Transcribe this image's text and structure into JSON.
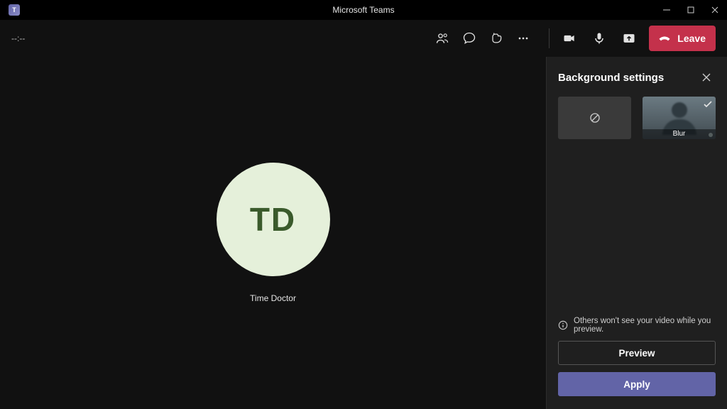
{
  "window": {
    "app_icon_text": "T",
    "title": "Microsoft Teams"
  },
  "toolbar": {
    "timer": "--:--",
    "leave_label": "Leave"
  },
  "stage": {
    "avatar_initials": "TD",
    "participant_name": "Time Doctor"
  },
  "panel": {
    "title": "Background settings",
    "options": {
      "none_label": "None",
      "blur_label": "Blur"
    },
    "notice_text": "Others won't see your video while you preview.",
    "preview_label": "Preview",
    "apply_label": "Apply"
  }
}
